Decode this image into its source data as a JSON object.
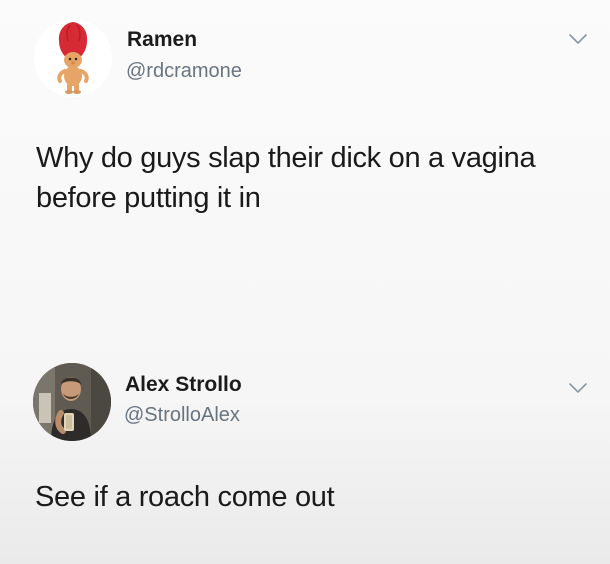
{
  "tweets": [
    {
      "display_name": "Ramen",
      "handle": "@rdcramone",
      "text_lines": [
        "Why do guys slap their dick on a vagina",
        "before putting it in"
      ],
      "avatar_icon": "troll-doll-avatar"
    },
    {
      "display_name": "Alex Strollo",
      "handle": "@StrolloAlex",
      "text_lines": [
        "See if a roach come out"
      ],
      "avatar_icon": "person-selfie-avatar"
    }
  ],
  "colors": {
    "handle": "#687480",
    "text": "#1a1a1a",
    "chevron": "#8899a6",
    "troll_hair": "#d62a35",
    "troll_skin": "#e6a567"
  }
}
